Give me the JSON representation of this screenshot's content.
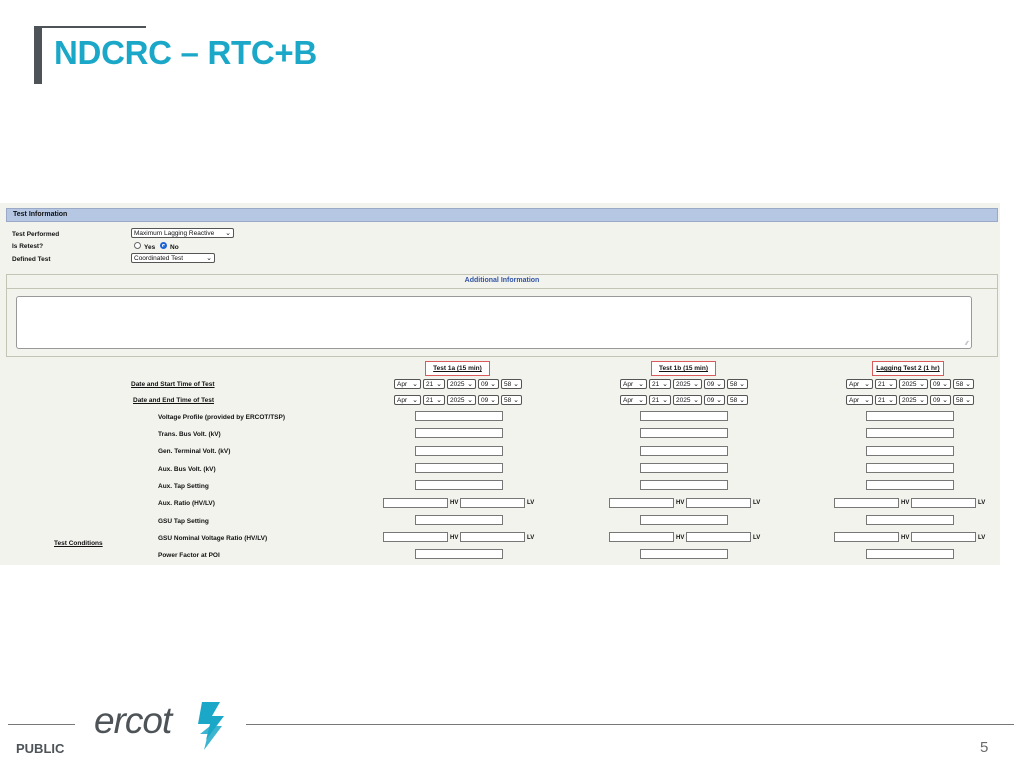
{
  "slide": {
    "title": "NDCRC – RTC+B",
    "public_label": "PUBLIC",
    "page_number": "5",
    "logo_text": "ercot",
    "brand_color": "#1ba8c8"
  },
  "test_information": {
    "header": "Test Information",
    "test_performed_label": "Test Performed",
    "test_performed_value": "Maximum Lagging Reactive",
    "is_retest_label": "Is Retest?",
    "yes_label": "Yes",
    "no_label": "No",
    "is_retest_selected": "No",
    "defined_test_label": "Defined Test",
    "defined_test_value": "Coordinated Test"
  },
  "additional_information": {
    "header": "Additional Information",
    "text_value": ""
  },
  "test_columns": [
    {
      "label": "Test 1a (15 min)",
      "start": {
        "month": "Apr",
        "day": "21",
        "year": "2025",
        "hour": "09",
        "minute": "58"
      },
      "end": {
        "month": "Apr",
        "day": "21",
        "year": "2025",
        "hour": "09",
        "minute": "58"
      }
    },
    {
      "label": "Test 1b (15 min)",
      "start": {
        "month": "Apr",
        "day": "21",
        "year": "2025",
        "hour": "09",
        "minute": "58"
      },
      "end": {
        "month": "Apr",
        "day": "21",
        "year": "2025",
        "hour": "09",
        "minute": "58"
      }
    },
    {
      "label": "Lagging Test 2 (1 hr)",
      "start": {
        "month": "Apr",
        "day": "21",
        "year": "2025",
        "hour": "09",
        "minute": "58"
      },
      "end": {
        "month": "Apr",
        "day": "21",
        "year": "2025",
        "hour": "09",
        "minute": "58"
      }
    }
  ],
  "rows": {
    "date_start_label": "Date and Start Time of Test",
    "date_end_label": "Date and End Time of Test",
    "voltage_profile": "Voltage Profile (provided by ERCOT/TSP)",
    "trans_bus_volt": "Trans. Bus Volt. (kV)",
    "gen_terminal_volt": "Gen. Terminal Volt. (kV)",
    "aux_bus_volt": "Aux. Bus Volt. (kV)",
    "aux_tap_setting": "Aux. Tap Setting",
    "aux_ratio": "Aux. Ratio (HV/LV)",
    "gsu_tap_setting": "GSU Tap Setting",
    "gsu_nominal_ratio": "GSU Nominal Voltage Ratio (HV/LV)",
    "power_factor": "Power Factor at POI",
    "test_conditions": "Test Conditions"
  },
  "units": {
    "hv": "HV",
    "lv": "LV"
  },
  "icons": {
    "dropdown": "chevron-down-icon",
    "resize": "resize-grip-icon"
  }
}
